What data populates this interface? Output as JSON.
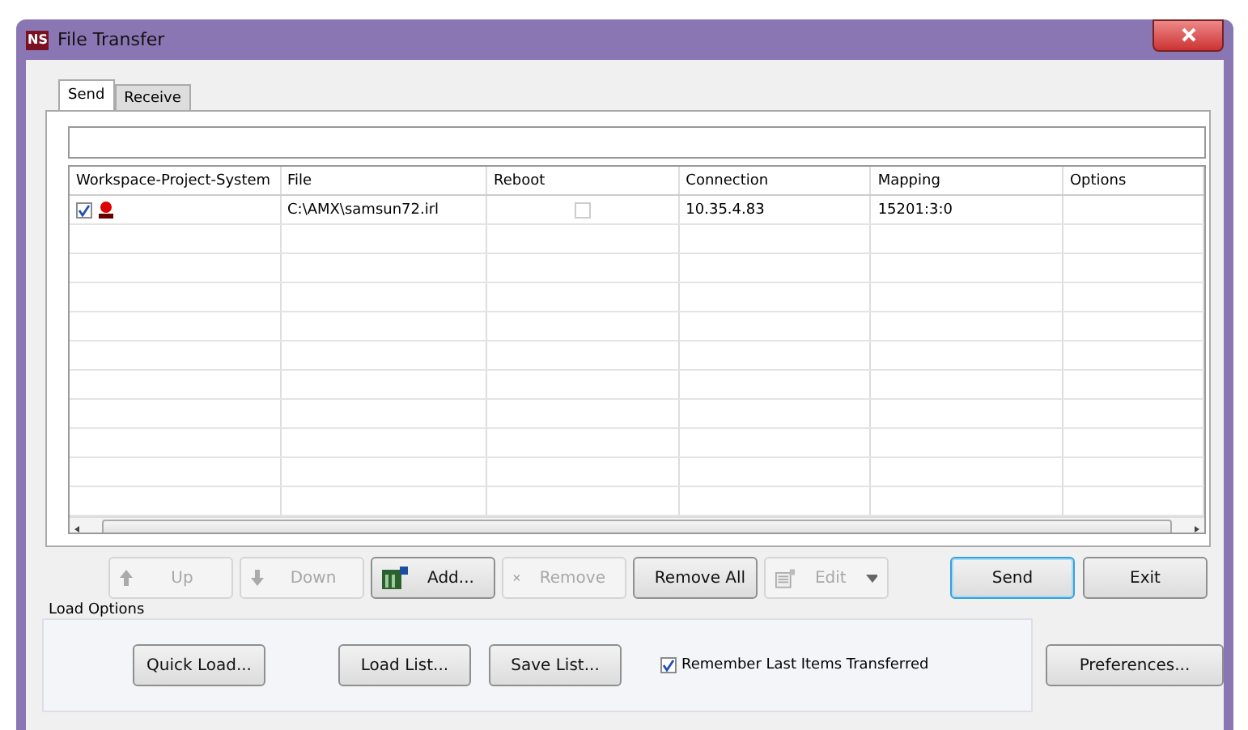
{
  "window": {
    "title": "File Transfer",
    "logo": "NS"
  },
  "tabs": [
    {
      "label": "Send",
      "selected": true
    },
    {
      "label": "Receive",
      "selected": false
    }
  ],
  "table": {
    "columns": [
      "Workspace-Project-System",
      "File",
      "Reboot",
      "Connection",
      "Mapping",
      "Options"
    ],
    "rows": [
      {
        "checked": true,
        "file": "C:\\AMX\\samsun72.irl",
        "reboot": false,
        "connection": "10.35.4.83",
        "mapping": "15201:3:0"
      }
    ]
  },
  "toolbar": [
    {
      "label": "Up",
      "disabled": true
    },
    {
      "label": "Down",
      "disabled": true
    },
    {
      "label": "Add...",
      "disabled": false
    },
    {
      "label": "Remove",
      "disabled": true
    },
    {
      "label": "Remove All",
      "disabled": false
    },
    {
      "label": "Edit",
      "disabled": true,
      "dropdown": true
    }
  ],
  "actions": [
    {
      "label": "Send",
      "default": true
    },
    {
      "label": "Exit",
      "default": false
    }
  ],
  "load_options": {
    "title": "Load Options",
    "buttons": [
      "Quick Load...",
      "Load List...",
      "Save List..."
    ],
    "remember": {
      "label": "Remember Last Items Transferred",
      "checked": true
    },
    "preferences": "Preferences..."
  }
}
